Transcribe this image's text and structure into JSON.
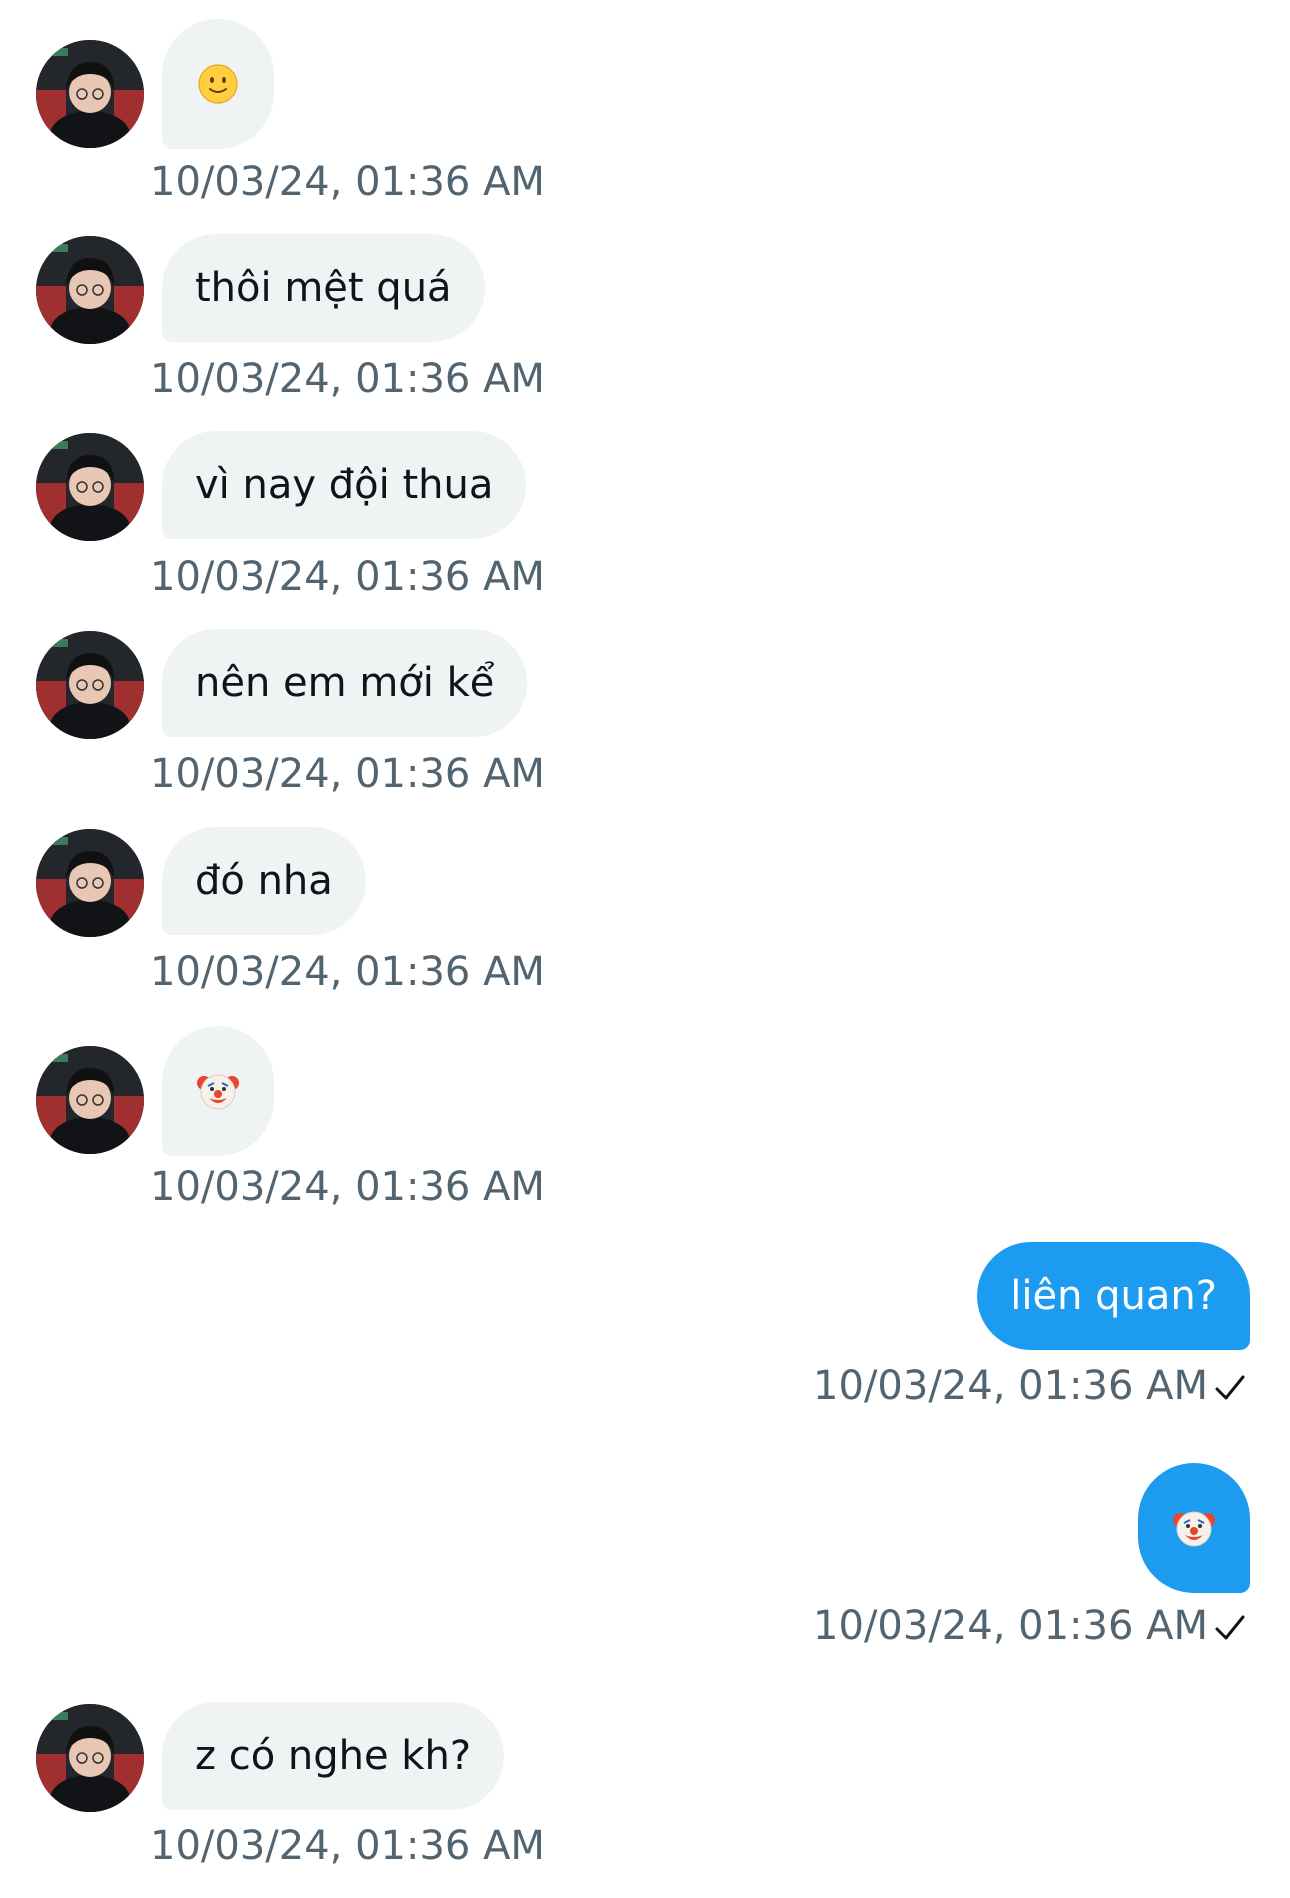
{
  "messages": [
    {
      "side": "in",
      "text": "",
      "emoji": "slightly-smiling-face-icon",
      "time": "10/03/24, 01:36 AM"
    },
    {
      "side": "in",
      "text": "thôi mệt quá",
      "time": "10/03/24, 01:36 AM"
    },
    {
      "side": "in",
      "text": "vì nay đội thua",
      "time": "10/03/24, 01:36 AM"
    },
    {
      "side": "in",
      "text": "nên em mới kể",
      "time": "10/03/24, 01:36 AM"
    },
    {
      "side": "in",
      "text": "đó nha",
      "time": "10/03/24, 01:36 AM"
    },
    {
      "side": "in",
      "text": "",
      "emoji": "clown-face-icon",
      "time": "10/03/24, 01:36 AM"
    },
    {
      "side": "out",
      "text": "liên quan?",
      "time": "10/03/24, 01:36 AM",
      "status": "sent-check-icon"
    },
    {
      "side": "out",
      "text": "",
      "emoji": "clown-face-icon",
      "time": "10/03/24, 01:36 AM",
      "status": "sent-check-icon"
    },
    {
      "side": "in",
      "text": "z có nghe kh?",
      "time": "10/03/24, 01:36 AM"
    }
  ],
  "colors": {
    "incoming_bubble": "#eff3f4",
    "outgoing_bubble": "#1d9bf0",
    "timestamp": "#536471",
    "text": "#0f1419"
  }
}
